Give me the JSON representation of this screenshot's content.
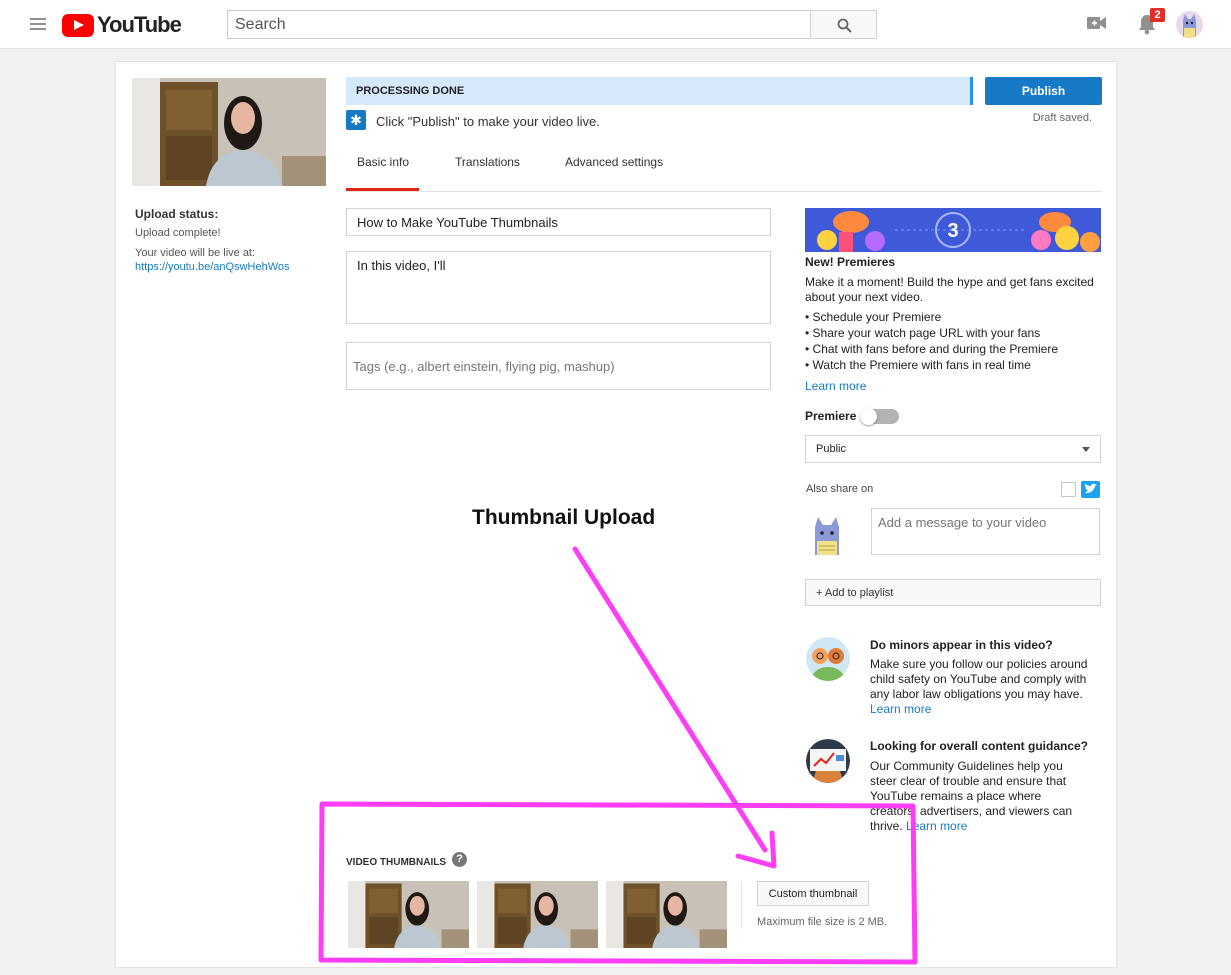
{
  "header": {
    "logo_text": "YouTube",
    "search_placeholder": "Search",
    "notification_count": "2"
  },
  "sidebar": {
    "upload_status_label": "Upload status:",
    "upload_complete": "Upload complete!",
    "live_at_label": "Your video will be live at:",
    "video_url": "https://youtu.be/anQswHehWos"
  },
  "status": {
    "processing": "PROCESSING DONE",
    "publish_label": "Publish",
    "draft_saved": "Draft saved.",
    "publish_hint": "Click \"Publish\" to make your video live."
  },
  "tabs": [
    {
      "label": "Basic info",
      "active": true
    },
    {
      "label": "Translations",
      "active": false
    },
    {
      "label": "Advanced settings",
      "active": false
    }
  ],
  "form": {
    "title_value": "How to Make YouTube Thumbnails",
    "description_value": "In this video, I'll",
    "tags_placeholder": "Tags (e.g., albert einstein, flying pig, mashup)"
  },
  "premieres": {
    "banner_number": "3",
    "title": "New! Premieres",
    "description": "Make it a moment! Build the hype and get fans excited about your next video.",
    "bullets": [
      "Schedule your Premiere",
      "Share your watch page URL with your fans",
      "Chat with fans before and during the Premiere",
      "Watch the Premiere with fans in real time"
    ],
    "learn_more": "Learn more"
  },
  "settings": {
    "premiere_label": "Premiere",
    "premiere_enabled": false,
    "privacy_value": "Public",
    "also_share_label": "Also share on",
    "share_placeholder": "Add a message to your video",
    "add_playlist_label": "+ Add to playlist"
  },
  "info_boxes": [
    {
      "title": "Do minors appear in this video?",
      "body": "Make sure you follow our policies around child safety on YouTube and comply with any labor law obligations you may have.",
      "link": "Learn more"
    },
    {
      "title": "Looking for overall content guidance?",
      "body": "Our Community Guidelines help you steer clear of trouble and ensure that YouTube remains a place where creators, advertisers, and viewers can thrive.",
      "link": "Learn more"
    }
  ],
  "annotation": {
    "title": "Thumbnail Upload",
    "color": "#ff3df5"
  },
  "thumbnails": {
    "label": "VIDEO THUMBNAILS",
    "help": "?",
    "custom_button": "Custom thumbnail",
    "max_size": "Maximum file size is 2 MB."
  },
  "colors": {
    "brand_red": "#ff0000",
    "accent_blue": "#167ac6",
    "processing_bg": "#d6e9fb"
  }
}
